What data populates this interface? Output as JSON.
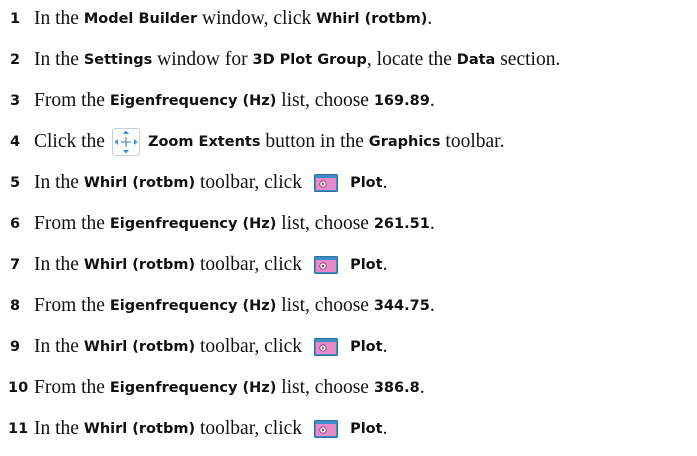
{
  "steps": [
    {
      "num": "1",
      "segments": [
        {
          "t": "In the "
        },
        {
          "t": "Model Builder",
          "b": true
        },
        {
          "t": " window, click "
        },
        {
          "t": "Whirl (rotbm)",
          "b": true
        },
        {
          "t": "."
        }
      ]
    },
    {
      "num": "2",
      "segments": [
        {
          "t": "In the "
        },
        {
          "t": "Settings",
          "b": true
        },
        {
          "t": " window for "
        },
        {
          "t": "3D Plot Group",
          "b": true
        },
        {
          "t": ", locate the "
        },
        {
          "t": "Data",
          "b": true
        },
        {
          "t": " section."
        }
      ]
    },
    {
      "num": "3",
      "segments": [
        {
          "t": "From the "
        },
        {
          "t": "Eigenfrequency (Hz)",
          "b": true
        },
        {
          "t": " list, choose "
        },
        {
          "t": "169.89",
          "b": true
        },
        {
          "t": "."
        }
      ]
    },
    {
      "num": "4",
      "segments": [
        {
          "t": "Click the"
        },
        {
          "icon": "zoom-extents-icon"
        },
        {
          "t": "Zoom Extents",
          "b": true
        },
        {
          "t": " button in the "
        },
        {
          "t": "Graphics",
          "b": true
        },
        {
          "t": " toolbar."
        }
      ]
    },
    {
      "num": "5",
      "segments": [
        {
          "t": "In the "
        },
        {
          "t": "Whirl (rotbm)",
          "b": true
        },
        {
          "t": " toolbar, click"
        },
        {
          "icon": "plot-icon"
        },
        {
          "t": "Plot",
          "b": true
        },
        {
          "t": "."
        }
      ]
    },
    {
      "num": "6",
      "segments": [
        {
          "t": "From the "
        },
        {
          "t": "Eigenfrequency (Hz)",
          "b": true
        },
        {
          "t": " list, choose "
        },
        {
          "t": "261.51",
          "b": true
        },
        {
          "t": "."
        }
      ]
    },
    {
      "num": "7",
      "segments": [
        {
          "t": "In the "
        },
        {
          "t": "Whirl (rotbm)",
          "b": true
        },
        {
          "t": " toolbar, click"
        },
        {
          "icon": "plot-icon"
        },
        {
          "t": "Plot",
          "b": true
        },
        {
          "t": "."
        }
      ]
    },
    {
      "num": "8",
      "segments": [
        {
          "t": "From the "
        },
        {
          "t": "Eigenfrequency (Hz)",
          "b": true
        },
        {
          "t": " list, choose "
        },
        {
          "t": "344.75",
          "b": true
        },
        {
          "t": "."
        }
      ]
    },
    {
      "num": "9",
      "segments": [
        {
          "t": "In the "
        },
        {
          "t": "Whirl (rotbm)",
          "b": true
        },
        {
          "t": " toolbar, click"
        },
        {
          "icon": "plot-icon"
        },
        {
          "t": "Plot",
          "b": true
        },
        {
          "t": "."
        }
      ]
    },
    {
      "num": "10",
      "segments": [
        {
          "t": "From the "
        },
        {
          "t": "Eigenfrequency (Hz)",
          "b": true
        },
        {
          "t": " list, choose "
        },
        {
          "t": "386.8",
          "b": true
        },
        {
          "t": "."
        }
      ]
    },
    {
      "num": "11",
      "segments": [
        {
          "t": "In the "
        },
        {
          "t": "Whirl (rotbm)",
          "b": true
        },
        {
          "t": " toolbar, click"
        },
        {
          "icon": "plot-icon"
        },
        {
          "t": "Plot",
          "b": true
        },
        {
          "t": "."
        }
      ]
    }
  ]
}
